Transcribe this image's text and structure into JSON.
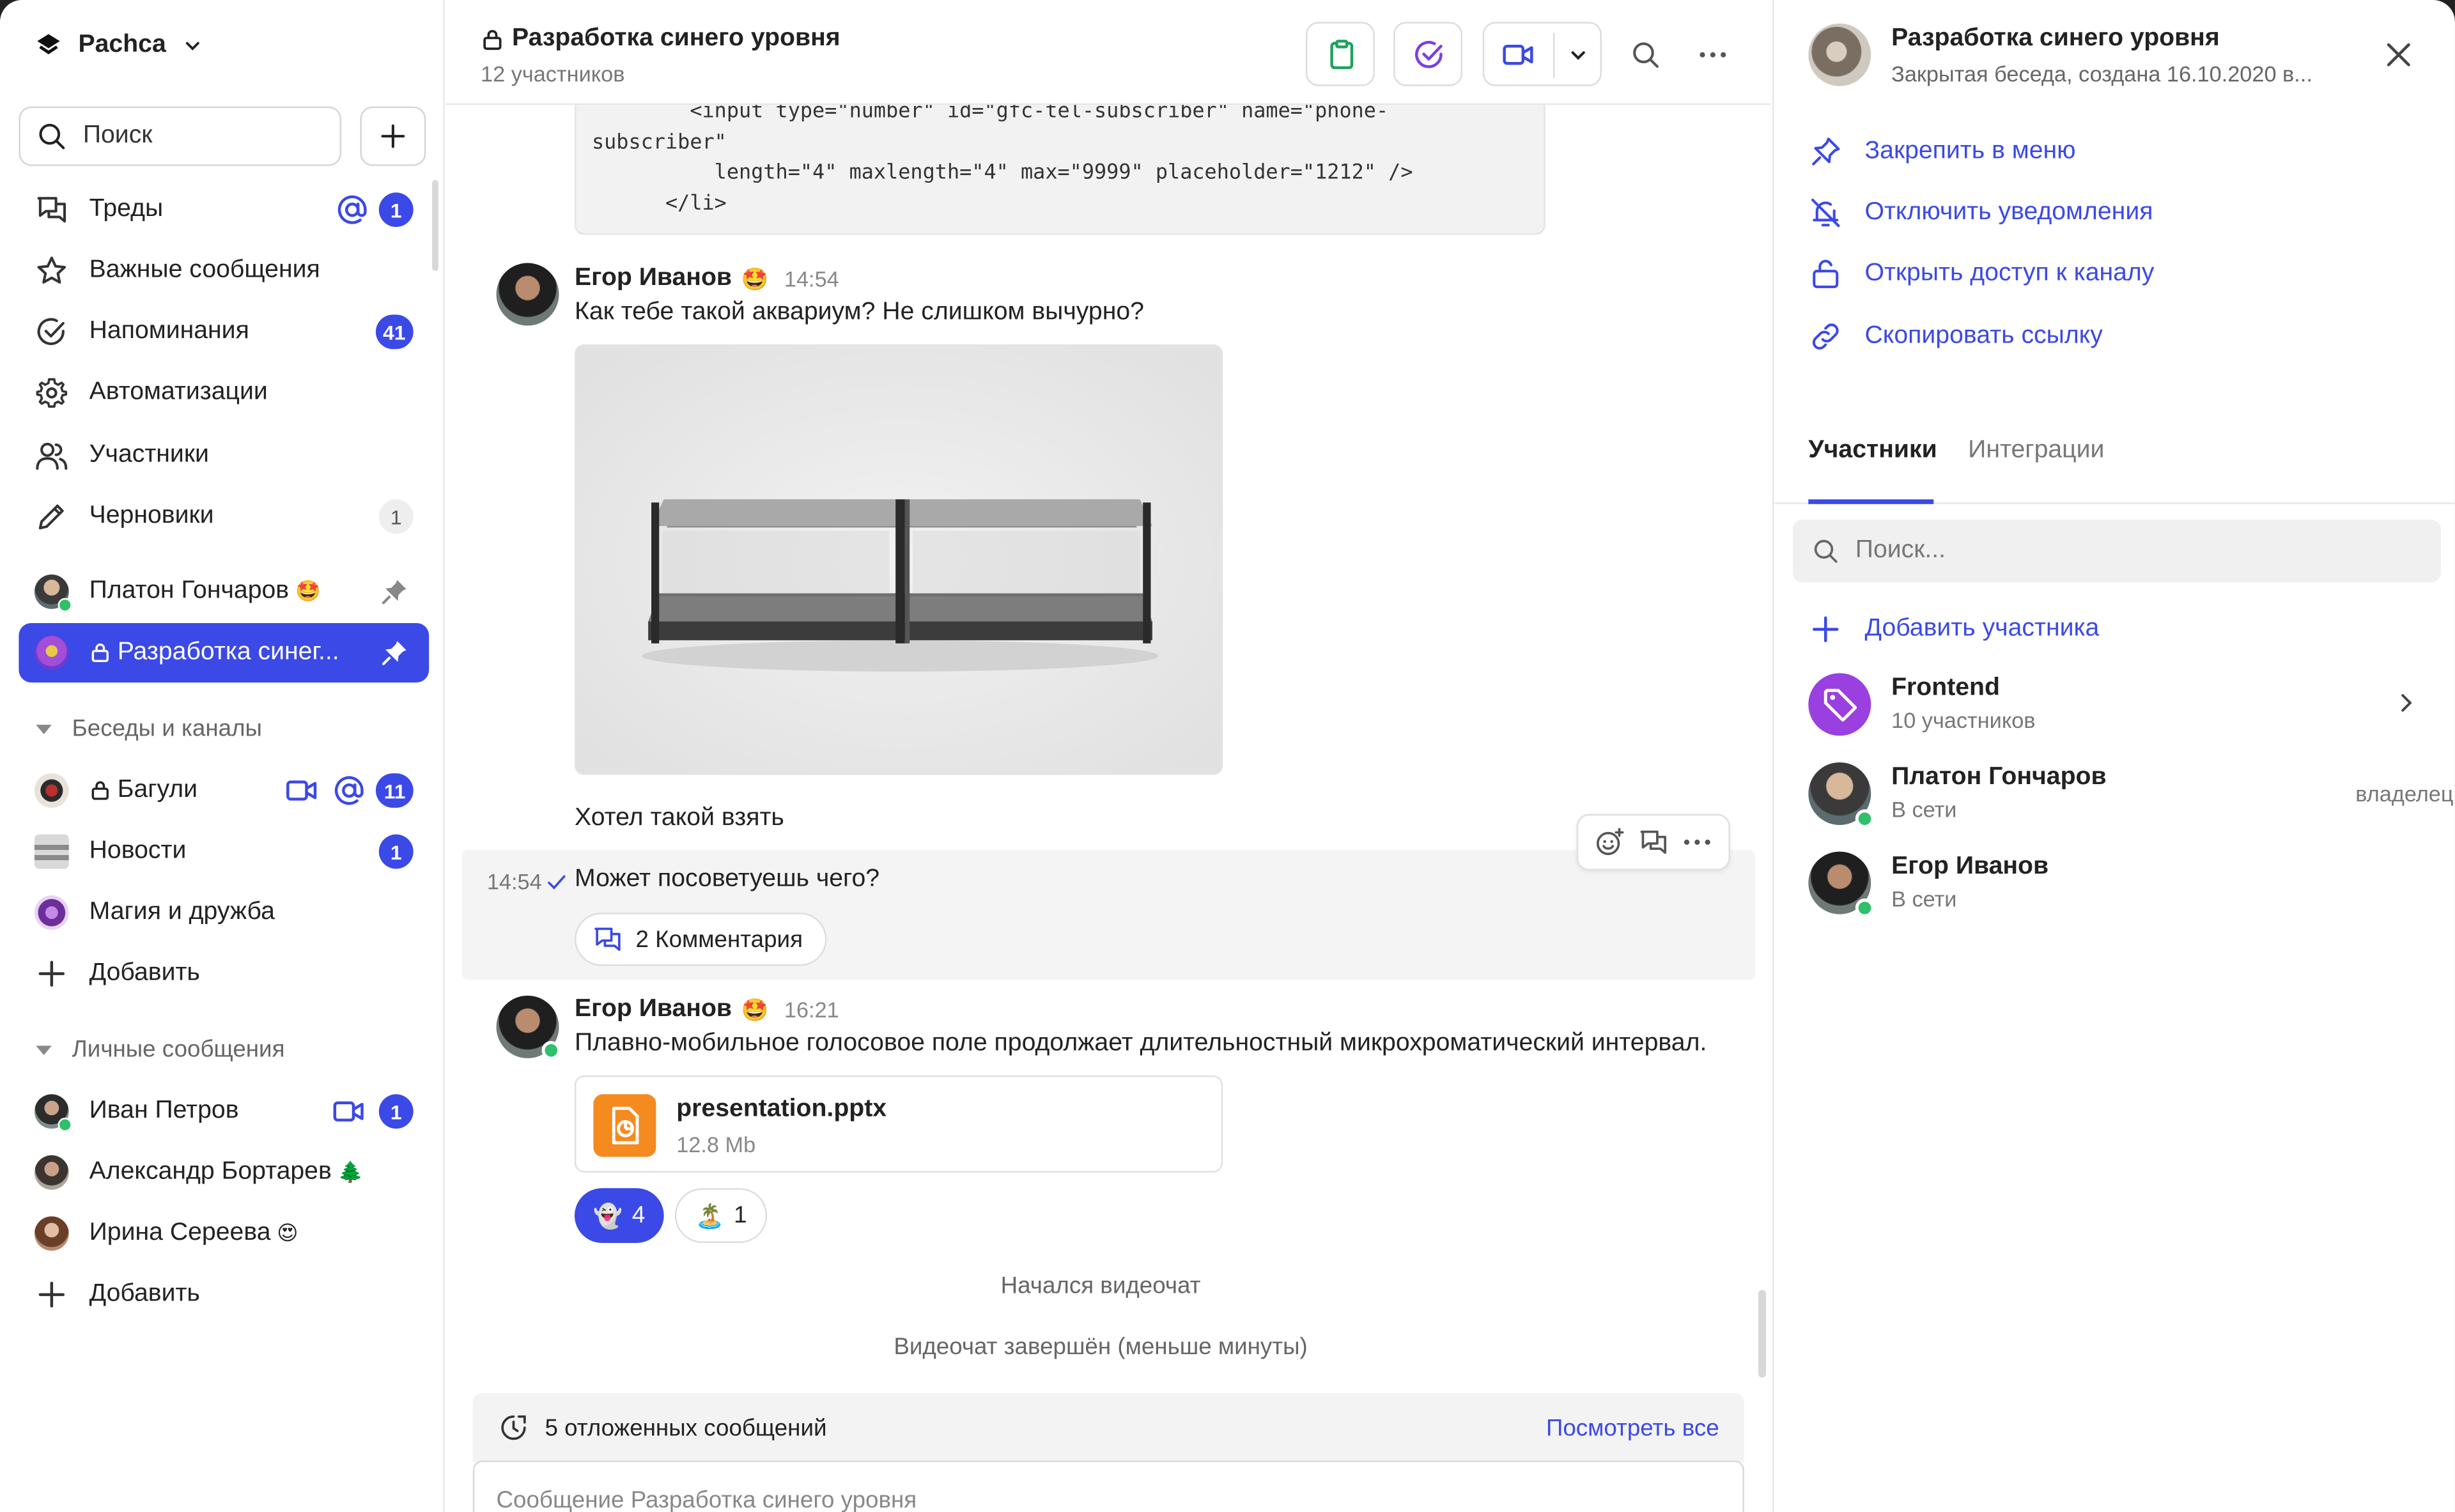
{
  "app": {
    "workspace": "Pachca",
    "search_label": "Поиск",
    "accent": "#3b49e6"
  },
  "sidebar": {
    "nav": [
      {
        "label": "Треды",
        "icon": "threads-icon",
        "mention": true,
        "badge": "1"
      },
      {
        "label": "Важные сообщения",
        "icon": "star-icon"
      },
      {
        "label": "Напоминания",
        "icon": "check-circle-icon",
        "badge": "41"
      },
      {
        "label": "Автоматизации",
        "icon": "gear-icon"
      },
      {
        "label": "Участники",
        "icon": "users-icon"
      },
      {
        "label": "Черновики",
        "icon": "pencil-icon",
        "badge": "1"
      }
    ],
    "pinned": [
      {
        "label": "Платон Гончаров",
        "emoji": "🤩"
      },
      {
        "label": "Разработка синег...",
        "active": true
      }
    ],
    "chats_section": "Беседы и каналы",
    "chats": [
      {
        "label": "Багули",
        "badge": "11"
      },
      {
        "label": "Новости",
        "badge": "1"
      },
      {
        "label": "Магия и дружба"
      }
    ],
    "add_label": "Добавить",
    "dm_section": "Личные сообщения",
    "dms": [
      {
        "label": "Иван Петров",
        "badge": "1"
      },
      {
        "label": "Александр Бортарев",
        "emoji": "🌲"
      },
      {
        "label": "Ирина Сереева",
        "emoji": "😍"
      }
    ]
  },
  "channel": {
    "title": "Разработка синего уровня",
    "subtitle": "12 участников"
  },
  "messages": {
    "code_lines": [
      "        <input type=\"number\" id=\"gfc-tel-subscriber\" name=\"phone-",
      "subscriber\"",
      "          length=\"4\" maxlength=\"4\" max=\"9999\" placeholder=\"1212\" />",
      "      </li>"
    ],
    "m1": {
      "author": "Егор Иванов",
      "emoji": "🤩",
      "time": "14:54",
      "text": "Как тебе такой аквариум? Не слишком вычурно?",
      "followup": "Хотел такой взять",
      "stamp": "14:54",
      "text2": "Может посоветуешь чего?",
      "comments": "2 Комментария"
    },
    "m2": {
      "author": "Егор Иванов",
      "emoji": "🤩",
      "time": "16:21",
      "text": "Плавно-мобильное голосовое поле продолжает длительностный микрохроматический интервал.",
      "file_name": "presentation.pptx",
      "file_size": "12.8 Mb",
      "reactions": [
        {
          "emoji": "👻",
          "count": "4",
          "mine": true
        },
        {
          "emoji": "🏝️",
          "count": "1",
          "mine": false
        }
      ]
    },
    "system": [
      "Начался видеочат",
      "Видеочат завершён (меньше минуты)"
    ],
    "deferred": "5 отложенных сообщений",
    "see_all": "Посмотреть все",
    "composer_placeholder": "Сообщение Разработка синего уровня"
  },
  "panel": {
    "title": "Разработка синего уровня",
    "subtitle": "Закрытая беседа, создана 16.10.2020 в...",
    "actions": [
      {
        "label": "Закрепить в меню",
        "icon": "pin-icon"
      },
      {
        "label": "Отключить уведомления",
        "icon": "bell-off-icon"
      },
      {
        "label": "Открыть доступ к каналу",
        "icon": "lock-open-icon"
      },
      {
        "label": "Скопировать ссылку",
        "icon": "link-icon"
      }
    ],
    "tabs": [
      "Участники",
      "Интеграции"
    ],
    "search_placeholder": "Поиск...",
    "add_member": "Добавить участника",
    "members": [
      {
        "name": "Frontend",
        "status": "10 участников",
        "role": ""
      },
      {
        "name": "Платон Гончаров",
        "status": "В сети",
        "role": "владелец"
      },
      {
        "name": "Егор Иванов",
        "status": "В сети",
        "role": ""
      }
    ]
  }
}
